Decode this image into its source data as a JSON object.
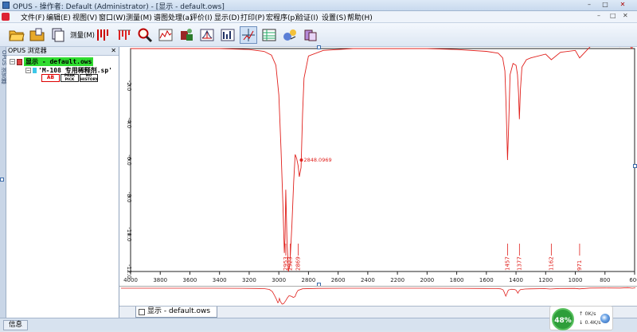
{
  "window": {
    "title": "OPUS - 操作者: Default  (Administrator) - [显示 - default.ows]",
    "min": "–",
    "max": "□",
    "close": "✕"
  },
  "menu": {
    "items": [
      "文件(F)",
      "编辑(E)",
      "视图(V)",
      "窗口(W)",
      "测量(M)",
      "谱图处理(a)",
      "评价(I)",
      "显示(D)",
      "打印(P)",
      "宏程序(p)",
      "验证(I)",
      "设置(S)",
      "帮助(H)"
    ],
    "right": [
      "–",
      "□",
      "✕"
    ]
  },
  "toolbar": {
    "measure_label": "测量(M)"
  },
  "sidebar": {
    "tab_label": "OPUS 浏览器",
    "vertical_tab": "OPUS 浏览器",
    "close": "✕",
    "root_label": "显示 - default.ows",
    "file_label": "'M-108 专用稀释剂.sp'",
    "blocks": [
      {
        "line1": "AB",
        "line2": "",
        "red": true
      },
      {
        "line1": "PEAK",
        "line2": "PICK",
        "red": false
      },
      {
        "line1": "NO",
        "line2": "HISTORY",
        "red": false
      }
    ]
  },
  "tabbar": {
    "tab_label": "显示 - default.ows"
  },
  "status": {
    "info": "信息"
  },
  "network": {
    "percent": "48%",
    "up": "0K/s",
    "down": "0.4K/s"
  },
  "chart_data": {
    "type": "line",
    "title": "",
    "xlabel": "",
    "ylabel": "",
    "xlim": [
      4000,
      600
    ],
    "ylim": [
      -12.0,
      0.0
    ],
    "x_ticks": [
      4000,
      3800,
      3600,
      3400,
      3200,
      3000,
      2800,
      2600,
      2400,
      2200,
      2000,
      1800,
      1600,
      1400,
      1200,
      1000,
      800,
      600
    ],
    "y_ticks": [
      -2.0,
      -4.0,
      -6.0,
      -8.0,
      -10.0,
      -12.0
    ],
    "y_tick_labels": [
      "-2.0",
      "-4.0",
      "-6.0",
      "-8.0",
      "-10.0",
      "-12.0"
    ],
    "series": [
      {
        "color": "#e0201c",
        "x": [
          4000,
          3700,
          3400,
          3200,
          3100,
          3050,
          3020,
          3000,
          2985,
          2972,
          2963,
          2958,
          2953,
          2945,
          2935,
          2925,
          2912,
          2900,
          2890,
          2880,
          2870,
          2862,
          2850,
          2840,
          2830,
          2800,
          2700,
          2500,
          2200,
          2000,
          1800,
          1600,
          1520,
          1490,
          1475,
          1468,
          1462,
          1457,
          1450,
          1440,
          1420,
          1400,
          1390,
          1383,
          1377,
          1370,
          1360,
          1330,
          1300,
          1200,
          1162,
          1100,
          1000,
          971,
          900,
          800,
          700,
          650,
          620,
          600
        ],
        "y": [
          0.0,
          0.0,
          0.0,
          -0.05,
          -0.15,
          -0.35,
          -0.9,
          -2.5,
          -5.5,
          -8.5,
          -11.0,
          -10.2,
          -7.6,
          -10.3,
          -12.0,
          -11.6,
          -9.5,
          -7.2,
          -5.7,
          -5.9,
          -6.3,
          -6.9,
          -6.4,
          -3.5,
          -1.6,
          -0.4,
          -0.1,
          0.0,
          0.0,
          0.0,
          -0.05,
          -0.15,
          -0.25,
          -0.5,
          -1.2,
          -2.8,
          -4.5,
          -6.0,
          -4.2,
          -1.4,
          -0.8,
          -0.9,
          -1.4,
          -2.4,
          -3.8,
          -2.2,
          -1.0,
          -0.6,
          -0.5,
          -0.3,
          -0.6,
          -0.2,
          -0.1,
          -0.5,
          0.1,
          0.2,
          0.1,
          0.4,
          0.0,
          0.3
        ]
      }
    ],
    "annotations": [
      {
        "x": 2848.0969,
        "y": -6.0,
        "text": "2848.0969"
      }
    ],
    "peak_labels": [
      {
        "x": 2953,
        "text": "2953"
      },
      {
        "x": 2923,
        "text": "2923"
      },
      {
        "x": 2869,
        "text": "2869"
      },
      {
        "x": 1457,
        "text": "1457"
      },
      {
        "x": 1377,
        "text": "1377"
      },
      {
        "x": 1162,
        "text": "1162"
      },
      {
        "x": 971,
        "text": "971"
      }
    ]
  }
}
